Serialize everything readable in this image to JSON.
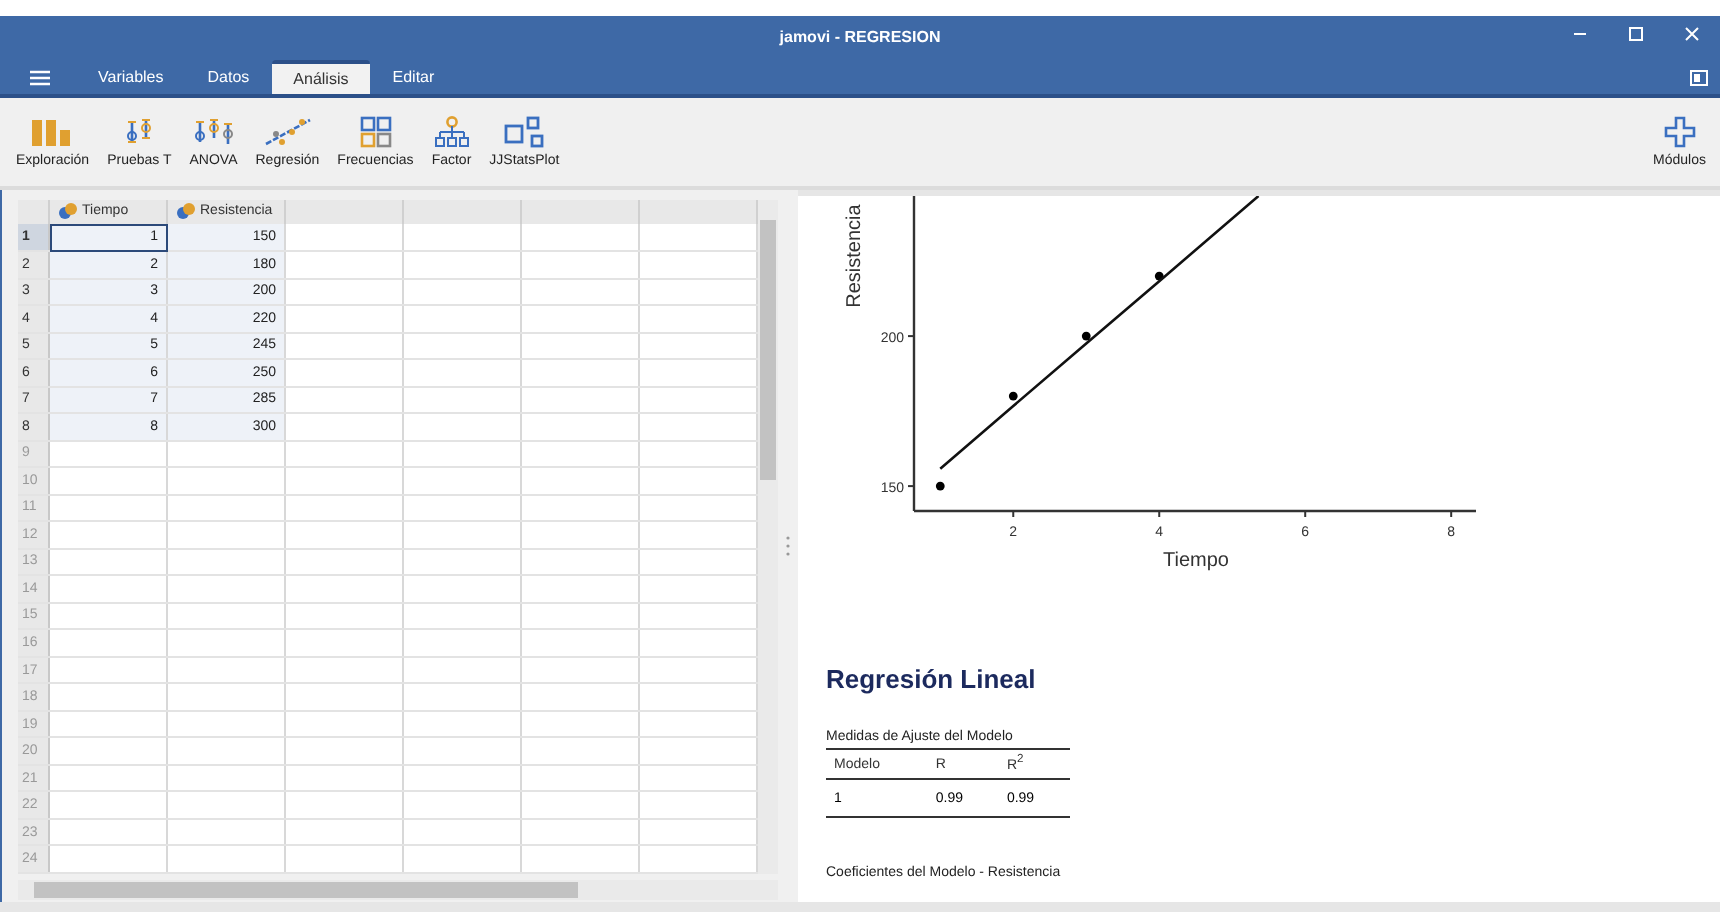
{
  "window": {
    "title": "jamovi - REGRESION"
  },
  "tabs": [
    {
      "label": "Variables",
      "selected": false
    },
    {
      "label": "Datos",
      "selected": false
    },
    {
      "label": "Análisis",
      "selected": true
    },
    {
      "label": "Editar",
      "selected": false
    }
  ],
  "toolbar": [
    {
      "label": "Exploración",
      "kind": "bars"
    },
    {
      "label": "Pruebas T",
      "kind": "ttest"
    },
    {
      "label": "ANOVA",
      "kind": "anova"
    },
    {
      "label": "Regresión",
      "kind": "regression"
    },
    {
      "label": "Frecuencias",
      "kind": "grid"
    },
    {
      "label": "Factor",
      "kind": "tree"
    },
    {
      "label": "JJStatsPlot",
      "kind": "squares"
    }
  ],
  "modules_button": {
    "label": "Módulos"
  },
  "spreadsheet": {
    "columns": [
      {
        "label": "Tiempo"
      },
      {
        "label": "Resistencia"
      }
    ],
    "rows": [
      {
        "number": "1",
        "cells": [
          "1",
          "150"
        ],
        "selected": true
      },
      {
        "number": "2",
        "cells": [
          "2",
          "180"
        ],
        "selected": false
      },
      {
        "number": "3",
        "cells": [
          "3",
          "200"
        ],
        "selected": false
      },
      {
        "number": "4",
        "cells": [
          "4",
          "220"
        ],
        "selected": false
      },
      {
        "number": "5",
        "cells": [
          "5",
          "245"
        ],
        "selected": false
      },
      {
        "number": "6",
        "cells": [
          "6",
          "250"
        ],
        "selected": false
      },
      {
        "number": "7",
        "cells": [
          "7",
          "285"
        ],
        "selected": false
      },
      {
        "number": "8",
        "cells": [
          "8",
          "300"
        ],
        "selected": false
      },
      {
        "number": "9",
        "cells": [],
        "selected": false
      },
      {
        "number": "10",
        "cells": [],
        "selected": false
      },
      {
        "number": "11",
        "cells": [],
        "selected": false
      },
      {
        "number": "12",
        "cells": [],
        "selected": false
      },
      {
        "number": "13",
        "cells": [],
        "selected": false
      },
      {
        "number": "14",
        "cells": [],
        "selected": false
      },
      {
        "number": "15",
        "cells": [],
        "selected": false
      },
      {
        "number": "16",
        "cells": [],
        "selected": false
      },
      {
        "number": "17",
        "cells": [],
        "selected": false
      },
      {
        "number": "18",
        "cells": [],
        "selected": false
      },
      {
        "number": "19",
        "cells": [],
        "selected": false
      },
      {
        "number": "20",
        "cells": [],
        "selected": false
      },
      {
        "number": "21",
        "cells": [],
        "selected": false
      },
      {
        "number": "22",
        "cells": [],
        "selected": false
      },
      {
        "number": "23",
        "cells": [],
        "selected": false
      },
      {
        "number": "24",
        "cells": [],
        "selected": false
      }
    ]
  },
  "results": {
    "chart_data": {
      "type": "scatter",
      "xlabel": "Tiempo",
      "ylabel": "Resistencia",
      "x": [
        1,
        2,
        3,
        4,
        5.36
      ],
      "series": [
        {
          "type": "scatter",
          "values": [
            150,
            180,
            200,
            220,
            null
          ]
        },
        {
          "type": "line",
          "values": [
            155.8,
            176.7,
            197.5,
            218.3,
            246.7
          ]
        }
      ],
      "xticks": [
        2,
        4,
        6,
        8
      ],
      "yticks": [
        150,
        200
      ],
      "xlim": [
        0.64,
        8.34
      ],
      "ylim": [
        141.7,
        246.7
      ]
    },
    "heading": "Regresión Lineal",
    "fit_table": {
      "title": "Medidas de Ajuste del Modelo",
      "columns": [
        "Modelo",
        "R",
        "R$^{2}$"
      ],
      "rows": [
        [
          "1",
          "0.99",
          "0.99"
        ]
      ]
    },
    "next_table_title": "Coeficientes del Modelo - Resistencia"
  }
}
